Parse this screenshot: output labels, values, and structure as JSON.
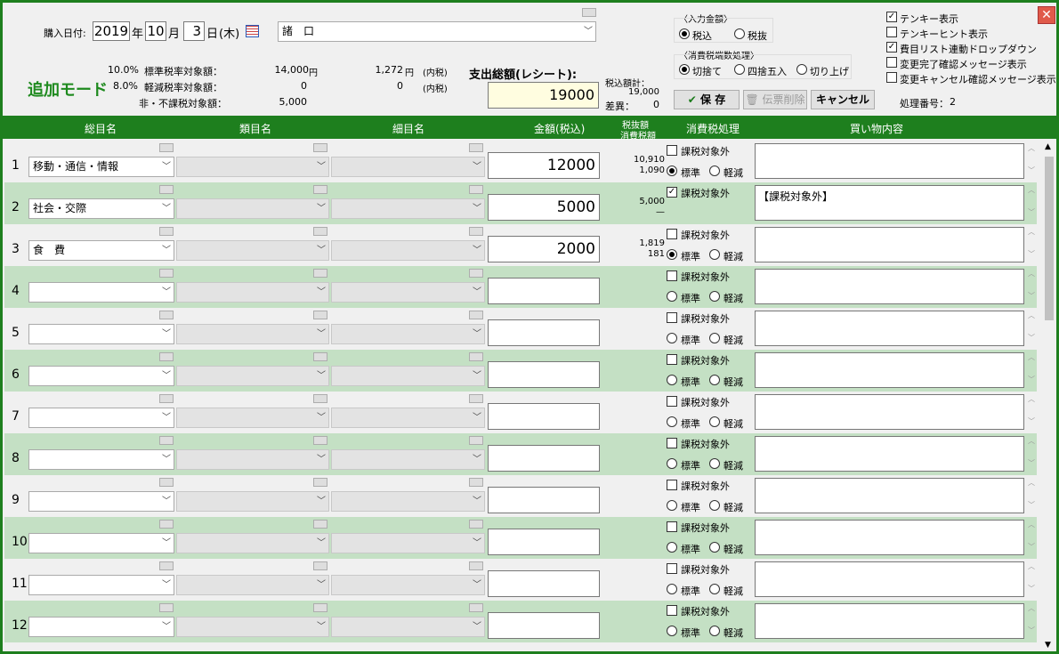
{
  "header": {
    "purchase_date_label": "購入日付:",
    "year": "2019",
    "year_unit": "年",
    "month": "10",
    "month_unit": "月",
    "day": "3",
    "day_unit": "日",
    "weekday": "(木)",
    "store": "諸　口",
    "mode": "追加モード",
    "std_rate": "10.0%",
    "std_label": "標準税率対象額：",
    "std_amount": "14,000",
    "std_yen": "円",
    "std_tax": "1,272",
    "std_tax_unit": "円　(内税)",
    "red_rate": "8.0%",
    "red_label": "軽減税率対象額：",
    "red_amount": "0",
    "red_tax": "0",
    "red_tax_unit": "(内税)",
    "nontax_label": "非・不課税対象額：",
    "nontax_amount": "5,000",
    "receipt_total_label": "支出総額(レシート):",
    "receipt_total": "19000",
    "taxin_total_label": "税込額計：",
    "taxin_total": "19,000",
    "diff_label": "差異：",
    "diff": "0",
    "input_amount_label": "〈入力金額〉",
    "input_taxin": "税込",
    "input_taxout": "税抜",
    "rounding_label": "〈消費税端数処理〉",
    "round_down": "切捨て",
    "round_half": "四捨五入",
    "round_up": "切り上げ",
    "save_label": "保 存",
    "delete_label": "伝票削除",
    "cancel_label": "キャンセル",
    "proc_label": "処理番号：",
    "proc_number": "2",
    "opt1": "テンキー表示",
    "opt2": "テンキーヒント表示",
    "opt3": "費目リスト連動ドロップダウン",
    "opt4": "変更完了確認メッセージ表示",
    "opt5": "変更キャンセル確認メッセージ表示"
  },
  "columns": {
    "c1": "総目名",
    "c2": "類目名",
    "c3": "細目名",
    "c4": "金額(税込)",
    "c5a": "税抜額",
    "c5b": "消費税額",
    "c6": "消費税処理",
    "c7": "買い物内容"
  },
  "row_labels": {
    "exempt": "課税対象外",
    "standard": "標準",
    "reduced": "軽減"
  },
  "rows": [
    {
      "no": "1",
      "cat": "移動・通信・情報",
      "amount": "12000",
      "taxex": "10,910",
      "tax": "1,090",
      "exempt": false,
      "memo": ""
    },
    {
      "no": "2",
      "cat": "社会・交際",
      "amount": "5000",
      "taxex": "5,000",
      "tax": "—",
      "exempt": true,
      "memo": "【課税対象外】"
    },
    {
      "no": "3",
      "cat": "食　費",
      "amount": "2000",
      "taxex": "1,819",
      "tax": "181",
      "exempt": false,
      "memo": ""
    },
    {
      "no": "4",
      "cat": "",
      "amount": "",
      "taxex": "",
      "tax": "",
      "exempt": false,
      "memo": ""
    },
    {
      "no": "5",
      "cat": "",
      "amount": "",
      "taxex": "",
      "tax": "",
      "exempt": false,
      "memo": ""
    },
    {
      "no": "6",
      "cat": "",
      "amount": "",
      "taxex": "",
      "tax": "",
      "exempt": false,
      "memo": ""
    },
    {
      "no": "7",
      "cat": "",
      "amount": "",
      "taxex": "",
      "tax": "",
      "exempt": false,
      "memo": ""
    },
    {
      "no": "8",
      "cat": "",
      "amount": "",
      "taxex": "",
      "tax": "",
      "exempt": false,
      "memo": ""
    },
    {
      "no": "9",
      "cat": "",
      "amount": "",
      "taxex": "",
      "tax": "",
      "exempt": false,
      "memo": ""
    },
    {
      "no": "10",
      "cat": "",
      "amount": "",
      "taxex": "",
      "tax": "",
      "exempt": false,
      "memo": ""
    },
    {
      "no": "11",
      "cat": "",
      "amount": "",
      "taxex": "",
      "tax": "",
      "exempt": false,
      "memo": ""
    },
    {
      "no": "12",
      "cat": "",
      "amount": "",
      "taxex": "",
      "tax": "",
      "exempt": false,
      "memo": ""
    }
  ]
}
